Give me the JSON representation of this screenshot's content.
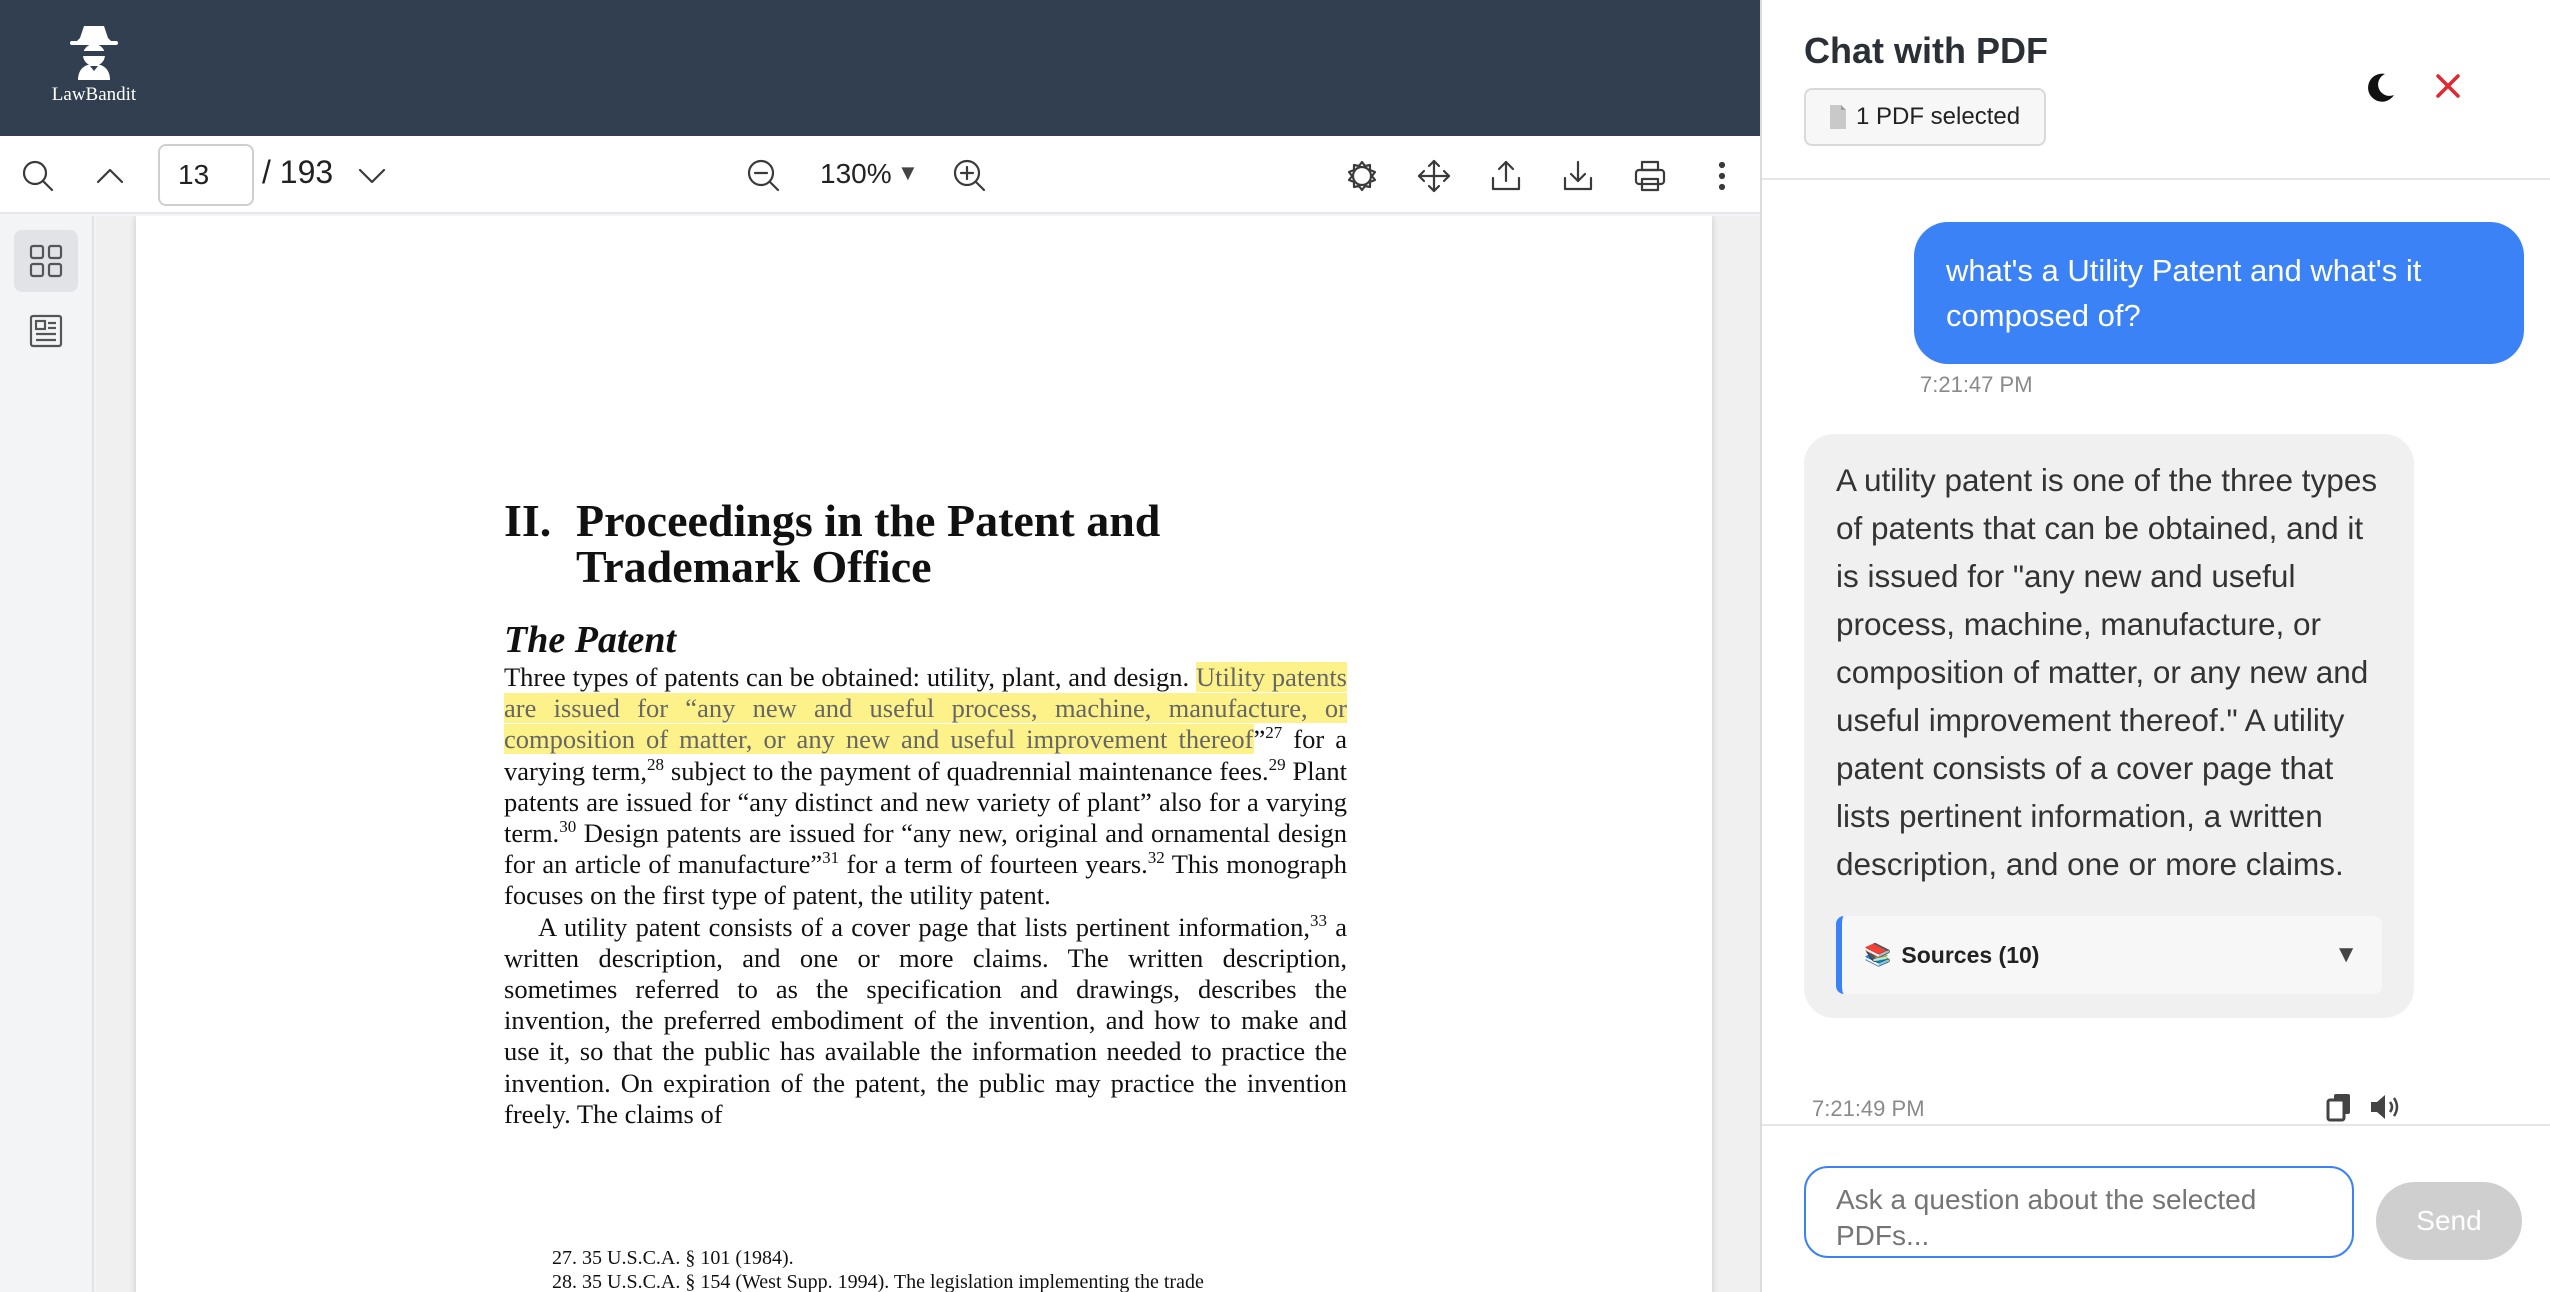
{
  "header": {
    "brand": "LawBandit"
  },
  "toolbar": {
    "page_number": "13",
    "page_total": "/ 193",
    "zoom": "130%",
    "icons": [
      "search-icon",
      "chevron-up-icon",
      "chevron-down-icon",
      "zoom-out-icon",
      "zoom-in-icon",
      "theme-icon",
      "pan-icon",
      "upload-icon",
      "download-icon",
      "print-icon",
      "more-icon"
    ]
  },
  "sidebar": {
    "icons": [
      "thumbnails-icon",
      "outline-icon"
    ]
  },
  "document": {
    "chapter_number": "II.",
    "chapter_title_line1": "Proceedings in the Patent and",
    "chapter_title_line2": "Trademark Office",
    "section_title": "The Patent",
    "p1_a": "Three types of patents can be obtained: utility, plant, and design. ",
    "p1_highlight": "Utility patents are issued for “any new and useful process, machine, manufacture, or composition of matter, or any new and useful improvement thereof",
    "p1_b": "”",
    "fn27": "27",
    "p1_c": " for a varying term,",
    "fn28": "28",
    "p1_d": " subject to the payment of quadrennial maintenance fees.",
    "fn29": "29",
    "p1_e": " Plant patents are issued for “any distinct and new variety of plant” also for a varying term.",
    "fn30": "30",
    "p1_f": " Design patents are issued for “any new, original and ornamental design for an article of manufacture”",
    "fn31": "31",
    "p1_g": " for a term of fourteen years.",
    "fn32": "32",
    "p1_h": " This monograph focuses on the first type of patent, the utility patent.",
    "p2_a": "A utility patent consists of a cover page that lists pertinent information,",
    "fn33": "33",
    "p2_b": " a written description, and one or more claims. The written description, sometimes referred to as the specification and drawings, describes the invention, the preferred embodiment of the invention, and how to make and use it, so that the public has available the information needed to practice the invention. On expiration of the patent, the public may practice the invention freely. The claims of",
    "footnote_27": "27. 35 U.S.C.A. § 101 (1984).",
    "footnote_28": "28. 35 U.S.C.A. § 154 (West Supp. 1994). The legislation implementing the trade"
  },
  "chat": {
    "title": "Chat with PDF",
    "pdf_selected": "1 PDF selected",
    "user_message": "what's a Utility Patent and what's it composed of?",
    "user_time": "7:21:47 PM",
    "bot_message": "A utility patent is one of the three types of patents that can be obtained, and it is issued for \"any new and useful process, machine, manufacture, or composition of matter, or any new and useful improvement thereof.\" A utility patent consists of a cover page that lists pertinent information, a written description, and one or more claims.",
    "sources_label": "Sources (10)",
    "bot_time": "7:21:49 PM",
    "input_placeholder": "Ask a question about the selected PDFs...",
    "send_label": "Send"
  },
  "colors": {
    "header_bg": "#323f51",
    "accent": "#3b82f6",
    "highlight": "#fdf28a",
    "close": "#e0282e",
    "send_disabled": "#cfcfcf"
  }
}
